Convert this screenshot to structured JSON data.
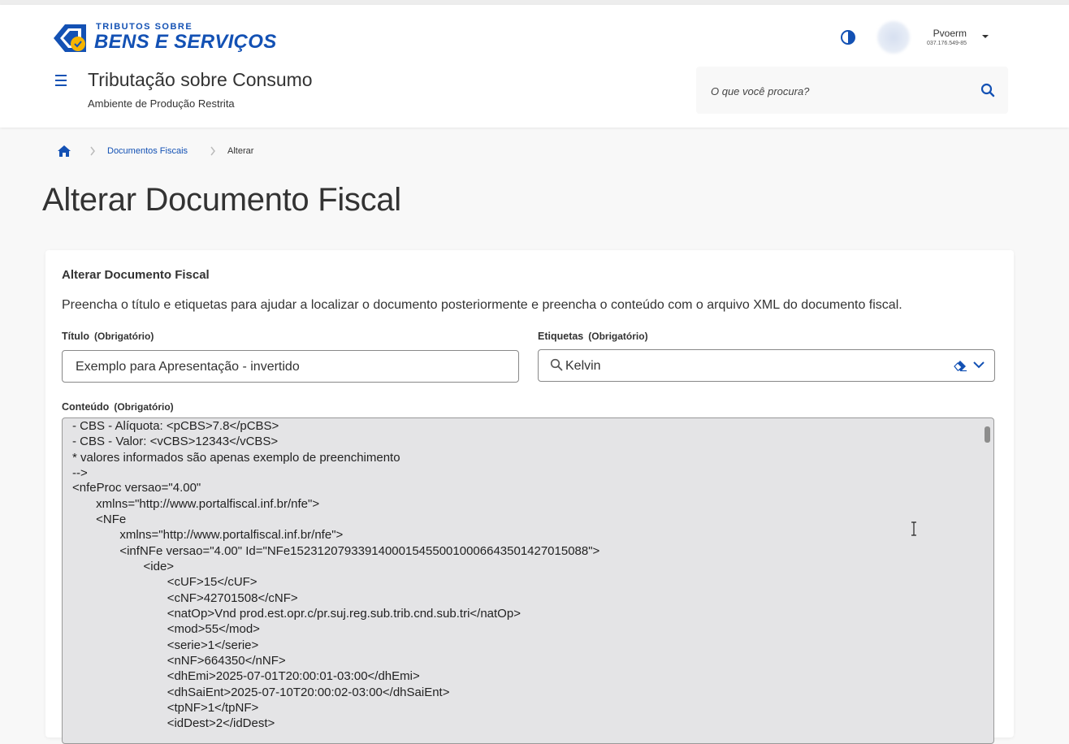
{
  "brand": {
    "small": "TRIBUTOS SOBRE",
    "big": "BENS E SERVIÇOS",
    "colors": {
      "primary": "#1351b4",
      "accent": "#f5b400"
    }
  },
  "header": {
    "app_title": "Tributação sobre Consumo",
    "app_subtitle": "Ambiente de Produção Restrita",
    "search_placeholder": "O que você procura?",
    "contrast_icon": "contrast-icon",
    "user": {
      "name": "Pvoerm",
      "id": "037.176.549-85"
    }
  },
  "breadcrumb": {
    "items": [
      "Documentos Fiscais"
    ],
    "current": "Alterar"
  },
  "page": {
    "title": "Alterar Documento Fiscal"
  },
  "form": {
    "card_title": "Alterar Documento Fiscal",
    "description": "Preencha o título e etiquetas para ajudar a localizar o documento posteriormente e preencha o conteúdo com o arquivo XML do documento fiscal.",
    "titulo_label": "Título",
    "titulo_required": "(Obrigatório)",
    "titulo_value": "Exemplo para Apresentação - invertido",
    "etiquetas_label": "Etiquetas",
    "etiquetas_required": "(Obrigatório)",
    "etiquetas_value": "Kelvin",
    "conteudo_label": "Conteúdo",
    "conteudo_required": "(Obrigatório)",
    "conteudo_lines": [
      "- CBS - Alíquota: <pCBS>7.8</pCBS>",
      "- CBS - Valor: <vCBS>12343</vCBS>",
      "* valores informados são apenas exemplo de preenchimento",
      "-->",
      "<nfeProc versao=\"4.00\"",
      "       xmlns=\"http://www.portalfiscal.inf.br/nfe\">",
      "       <NFe",
      "              xmlns=\"http://www.portalfiscal.inf.br/nfe\">",
      "              <infNFe versao=\"4.00\" Id=\"NFe15231207933914000154550010006643501427015088\">",
      "                     <ide>",
      "                            <cUF>15</cUF>",
      "                            <cNF>42701508</cNF>",
      "                            <natOp>Vnd prod.est.opr.c/pr.suj.reg.sub.trib.cnd.sub.tri</natOp>",
      "                            <mod>55</mod>",
      "                            <serie>1</serie>",
      "                            <nNF>664350</nNF>",
      "                            <dhEmi>2025-07-01T20:00:01-03:00</dhEmi>",
      "                            <dhSaiEnt>2025-07-10T20:00:02-03:00</dhSaiEnt>",
      "                            <tpNF>1</tpNF>",
      "                            <idDest>2</idDest>"
    ]
  }
}
